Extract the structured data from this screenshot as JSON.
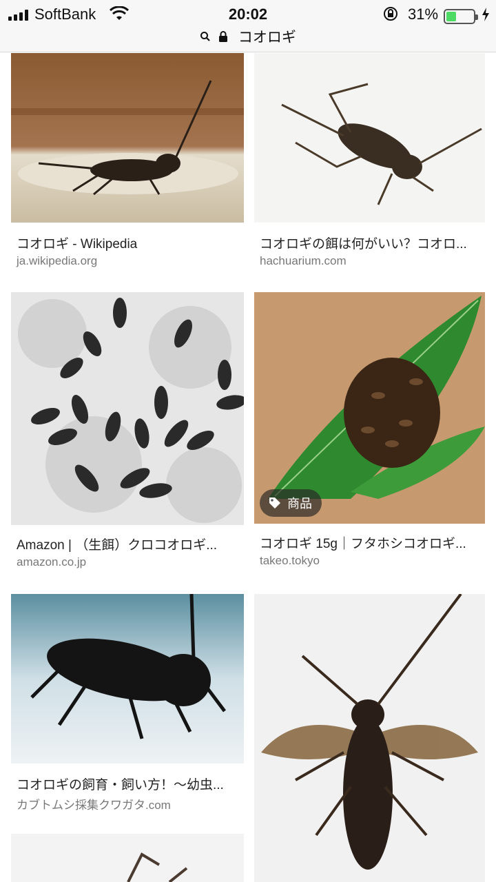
{
  "status_bar": {
    "carrier": "SoftBank",
    "time": "20:02",
    "battery_percent": "31%",
    "battery_level": 0.31,
    "icons": [
      "signal-icon",
      "wifi-icon",
      "rotation-lock-icon",
      "battery-icon",
      "charging-icon"
    ]
  },
  "address_bar": {
    "query": "コオロギ",
    "icons": [
      "search-icon",
      "lock-icon"
    ]
  },
  "results": [
    {
      "title": "コオロギ - Wikipedia",
      "source": "ja.wikipedia.org"
    },
    {
      "title": "コオロギの餌は何がいい？コオロ...",
      "source": "hachuarium.com"
    },
    {
      "title": "Amazon | （生餌）クロコオロギ...",
      "source": "amazon.co.jp"
    },
    {
      "title": "コオロギ 15g｜フタホシコオロギ...",
      "source": "takeo.tokyo",
      "badge": "商品"
    },
    {
      "title": "コオロギの飼育・飼い方！〜幼虫...",
      "source": "カブトムシ採集クワガタ.com"
    },
    {
      "title": "",
      "source": ""
    },
    {
      "title": "",
      "source": ""
    }
  ],
  "colors": {
    "battery_fill": "#4cd964",
    "title_text": "#222222",
    "domain_text": "#777777"
  }
}
